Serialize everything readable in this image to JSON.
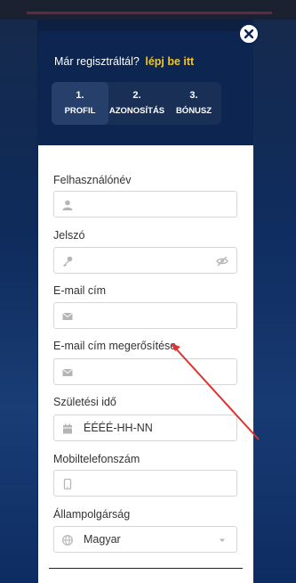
{
  "login_prompt": {
    "text": "Már regisztráltál?",
    "link": "lépj be itt"
  },
  "steps": [
    {
      "number": "1.",
      "label": "PROFIL",
      "active": true
    },
    {
      "number": "2.",
      "label": "AZONOSÍTÁS",
      "active": false
    },
    {
      "number": "3.",
      "label": "BÓNUSZ",
      "active": false
    }
  ],
  "form": {
    "username": {
      "label": "Felhasználónév",
      "icon": "user-icon",
      "value": ""
    },
    "password": {
      "label": "Jelszó",
      "icon": "key-icon",
      "value": ""
    },
    "email": {
      "label": "E-mail cím",
      "icon": "envelope-icon",
      "value": ""
    },
    "email_confirm": {
      "label": "E-mail cím megerősítése",
      "icon": "envelope-icon",
      "value": ""
    },
    "birthdate": {
      "label": "Születési idő",
      "icon": "calendar-icon",
      "value": "ÉÉÉÉ-HH-NN"
    },
    "mobile": {
      "label": "Mobiltelefonszám",
      "icon": "mobile-icon",
      "value": ""
    },
    "citizenship": {
      "label": "Állampolgárság",
      "icon": "globe-icon",
      "value": "Magyar"
    }
  },
  "colors": {
    "accent_link": "#f4c51d",
    "header_bg": "#0c2551",
    "annotation_arrow": "#e0322f"
  }
}
